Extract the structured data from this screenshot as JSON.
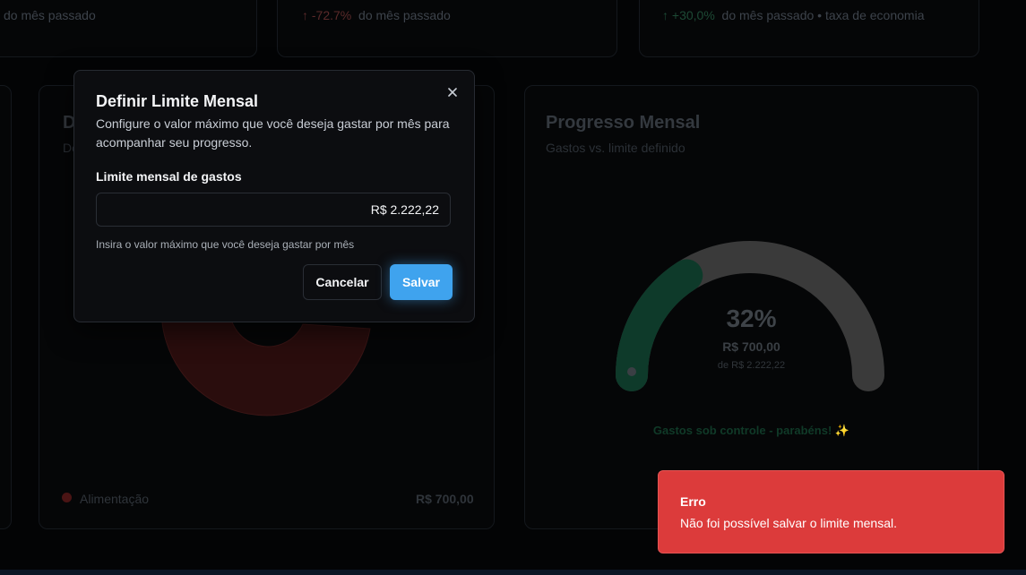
{
  "stats": [
    {
      "change": "",
      "text": "do mês passado"
    },
    {
      "change": "↑ -72.7%",
      "text": "do mês passado"
    },
    {
      "change": "↑ +30,0%",
      "text": "do mês passado • taxa de economia"
    }
  ],
  "category_card": {
    "title_partial": "D",
    "subtitle_partial": "De",
    "legend": [
      {
        "label": "Alimentação",
        "value": "R$ 700,00"
      }
    ]
  },
  "progress_card": {
    "title": "Progresso Mensal",
    "subtitle": "Gastos vs. limite definido",
    "percent_label": "32%",
    "spent": "R$ 700,00",
    "limit": "de R$ 2.222,22",
    "status": "Gastos sob controle - parabéns! ✨",
    "progress": 0.32,
    "colors": {
      "fill": "#0e3a2a",
      "track": "#3a3a3a"
    }
  },
  "modal": {
    "title": "Definir Limite Mensal",
    "description": "Configure o valor máximo que você deseja gastar por mês para acompanhar seu progresso.",
    "field_label": "Limite mensal de gastos",
    "field_value": "R$ 2.222,22",
    "help": "Insira o valor máximo que você deseja gastar por mês",
    "cancel": "Cancelar",
    "save": "Salvar",
    "close_icon": "close-icon"
  },
  "toast": {
    "title": "Erro",
    "message": "Não foi possível salvar o limite mensal.",
    "color": "#dc3b3b"
  }
}
